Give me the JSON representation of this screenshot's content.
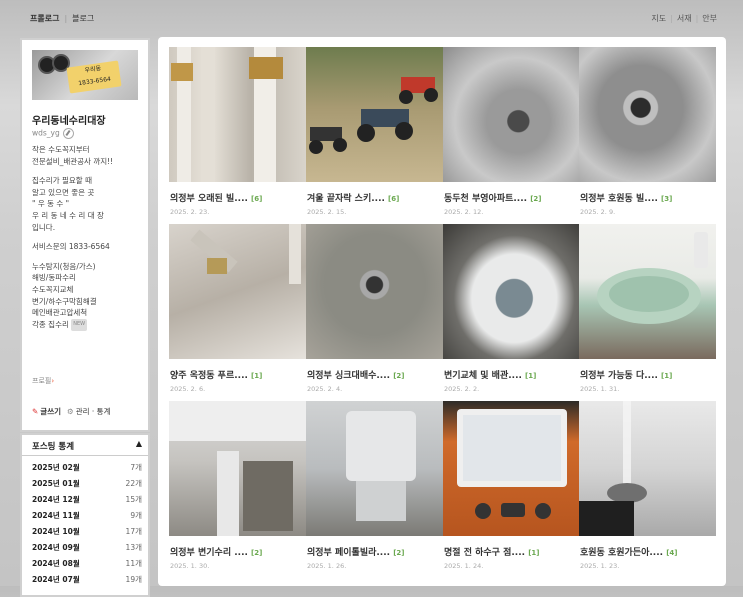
{
  "topnav": {
    "left": [
      "프롤로그",
      "블로그"
    ],
    "right": [
      "지도",
      "서재",
      "안부"
    ]
  },
  "profile": {
    "name": "우리동네수리대장",
    "id": "wds_yg",
    "tag_text": [
      "우리동",
      "1833-6564"
    ],
    "intro_lines": [
      "작은 수도꼭지부터",
      "전문설비_배관공사 까지!!",
      "",
      "집수리가 필요할 때",
      "알고 있으면 좋은 곳",
      "\" 우 동 수 \"",
      "우 리 동 네 수 리 대 장",
      "입니다.",
      "",
      "서비스문의 1833-6564",
      "",
      "누수탐지(청음/가스)",
      "해빙/동파수리",
      "수도꼭지교체",
      "변기/하수구막힘해결",
      "메인배관고압세척",
      "각종 집수리"
    ],
    "intro_badge": "NEW",
    "profile_link": "프로필",
    "write_label": "글쓰기",
    "manage_label": "관리 · 통계"
  },
  "stats": {
    "title": "포스팅 통계",
    "toggle": "▲",
    "rows": [
      {
        "month": "2025년 02월",
        "count": "7개"
      },
      {
        "month": "2025년 01월",
        "count": "22개"
      },
      {
        "month": "2024년 12월",
        "count": "15개"
      },
      {
        "month": "2024년 11월",
        "count": "9개"
      },
      {
        "month": "2024년 10월",
        "count": "17개"
      },
      {
        "month": "2024년 09월",
        "count": "13개"
      },
      {
        "month": "2024년 08월",
        "count": "11개"
      },
      {
        "month": "2024년 07월",
        "count": "19개"
      }
    ]
  },
  "posts": [
    {
      "title": "의정부 오래된 빌....",
      "count": "[6]",
      "date": "2025. 2. 23."
    },
    {
      "title": "겨울 끝자락 스키....",
      "count": "[6]",
      "date": "2025. 2. 15."
    },
    {
      "title": "동두천 부영아파트....",
      "count": "[2]",
      "date": "2025. 2. 12."
    },
    {
      "title": "의정부 호원동 빌....",
      "count": "[3]",
      "date": "2025. 2. 9."
    },
    {
      "title": "양주 옥정동 푸르....",
      "count": "[1]",
      "date": "2025. 2. 6."
    },
    {
      "title": "의정부 싱크대배수....",
      "count": "[2]",
      "date": "2025. 2. 4."
    },
    {
      "title": "변기교체 및 배관....",
      "count": "[1]",
      "date": "2025. 2. 2."
    },
    {
      "title": "의정부 가능동 다....",
      "count": "[1]",
      "date": "2025. 1. 31."
    },
    {
      "title": "의정부 변기수리 ....",
      "count": "[2]",
      "date": "2025. 1. 30."
    },
    {
      "title": "의정부 페이톨빌라....",
      "count": "[2]",
      "date": "2025. 1. 26."
    },
    {
      "title": "명절 전 하수구 점....",
      "count": "[1]",
      "date": "2025. 1. 24."
    },
    {
      "title": "호원동 호원가든아....",
      "count": "[4]",
      "date": "2025. 1. 23."
    }
  ]
}
